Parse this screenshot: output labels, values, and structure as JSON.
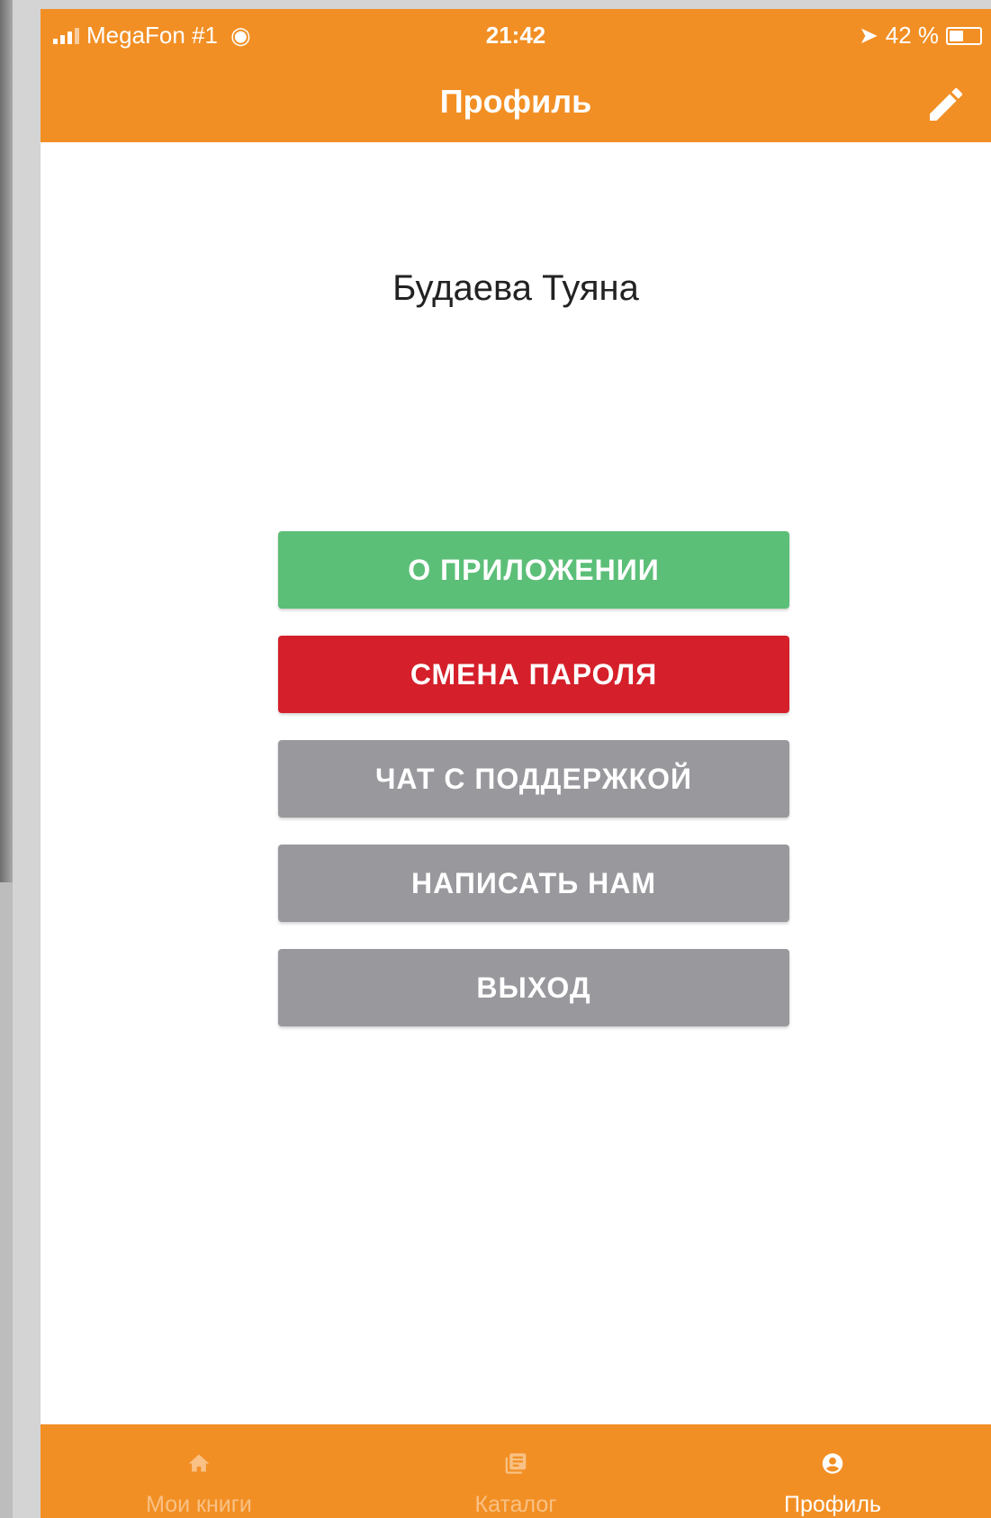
{
  "status_bar": {
    "carrier": "MegaFon #1",
    "time": "21:42",
    "battery_percent": "42 %"
  },
  "header": {
    "title": "Профиль",
    "edit_icon": "pencil-icon"
  },
  "profile": {
    "name": "Будаева Туяна"
  },
  "buttons": [
    {
      "label": "О ПРИЛОЖЕНИИ",
      "color": "#5cbf78"
    },
    {
      "label": "СМЕНА ПАРОЛЯ",
      "color": "#d51f2a"
    },
    {
      "label": "ЧАТ С ПОДДЕРЖКОЙ",
      "color": "#98989d"
    },
    {
      "label": "НАПИСАТЬ НАМ",
      "color": "#98989d"
    },
    {
      "label": "ВЫХОД",
      "color": "#98989d"
    }
  ],
  "tab_bar": {
    "items": [
      {
        "label": "Мои книги",
        "icon": "home-icon",
        "active": false
      },
      {
        "label": "Каталог",
        "icon": "catalog-icon",
        "active": false
      },
      {
        "label": "Профиль",
        "icon": "profile-icon",
        "active": true
      }
    ]
  },
  "colors": {
    "accent": "#f28f24",
    "tab_inactive": "#f9c185",
    "tab_active": "#ffffff"
  }
}
